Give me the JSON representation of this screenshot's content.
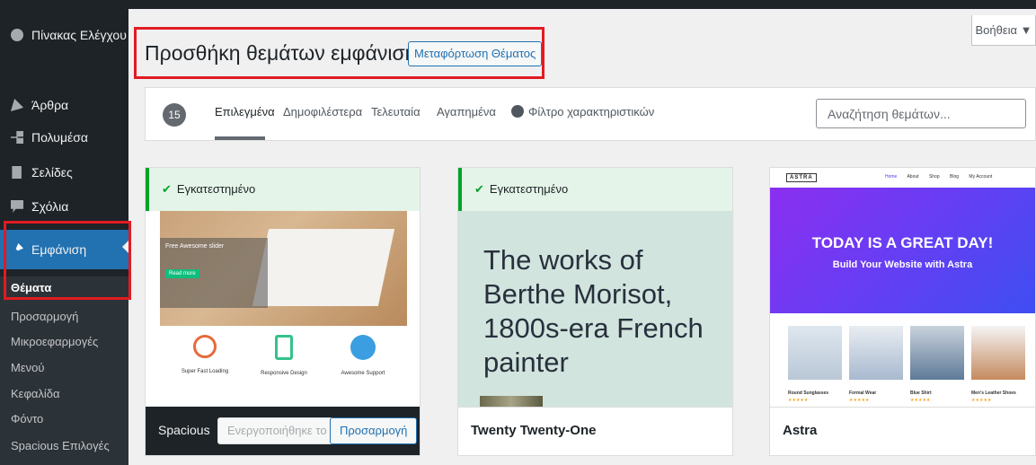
{
  "sidebar": {
    "items": [
      {
        "label": "Πίνακας Ελέγχου",
        "icon": "dashboard-icon"
      },
      {
        "label": "Άρθρα",
        "icon": "pushpin-icon"
      },
      {
        "label": "Πολυμέσα",
        "icon": "media-icon"
      },
      {
        "label": "Σελίδες",
        "icon": "page-icon"
      },
      {
        "label": "Σχόλια",
        "icon": "comment-icon"
      },
      {
        "label": "Εμφάνιση",
        "icon": "paintbrush-icon"
      }
    ],
    "submenu": [
      "Θέματα",
      "Προσαρμογή",
      "Μικροεφαρμογές",
      "Μενού",
      "Κεφαλίδα",
      "Φόντο",
      "Spacious Επιλογές"
    ]
  },
  "header": {
    "title": "Προσθήκη θεμάτων εμφάνισης",
    "upload_label": "Μεταφόρτωση Θέματος",
    "help_label": "Βοήθεια ▼"
  },
  "filters": {
    "count": "15",
    "tabs": [
      "Επιλεγμένα",
      "Δημοφιλέστερα",
      "Τελευταία",
      "Αγαπημένα",
      "Φίλτρο χαρακτηριστικών"
    ],
    "search_placeholder": "Αναζήτηση θεμάτων..."
  },
  "themes": [
    {
      "name": "Spacious",
      "status": "Εγκατεστημένο",
      "activated_label": "Ενεργοποιήθηκε το",
      "customize_label": "Προσαρμογή",
      "preview": {
        "slider_title": "Free Awesome slider",
        "read_more": "Read more",
        "features": [
          "Super Fast Loading",
          "Responsive Design",
          "Awesome Support"
        ]
      }
    },
    {
      "name": "Twenty Twenty-One",
      "status": "Εγκατεστημένο",
      "preview": {
        "headline": "The works of Berthe Morisot, 1800s-era French painter"
      }
    },
    {
      "name": "Astra",
      "preview": {
        "logo": "ASTRA",
        "nav": [
          "Home",
          "About",
          "Shop",
          "Blog",
          "My Account"
        ],
        "hero_title": "TODAY IS A GREAT DAY!",
        "hero_subtitle": "Build Your Website with Astra",
        "products": [
          "Round Sunglasses",
          "Formal Wear",
          "Blue Shirt",
          "Men's Leather Shoes"
        ],
        "stars": "★★★★★"
      }
    }
  ],
  "colors": {
    "accent": "#2271b1",
    "highlight": "#e11b22",
    "installed": "#00a32a",
    "sidebar": "#1d2327"
  }
}
